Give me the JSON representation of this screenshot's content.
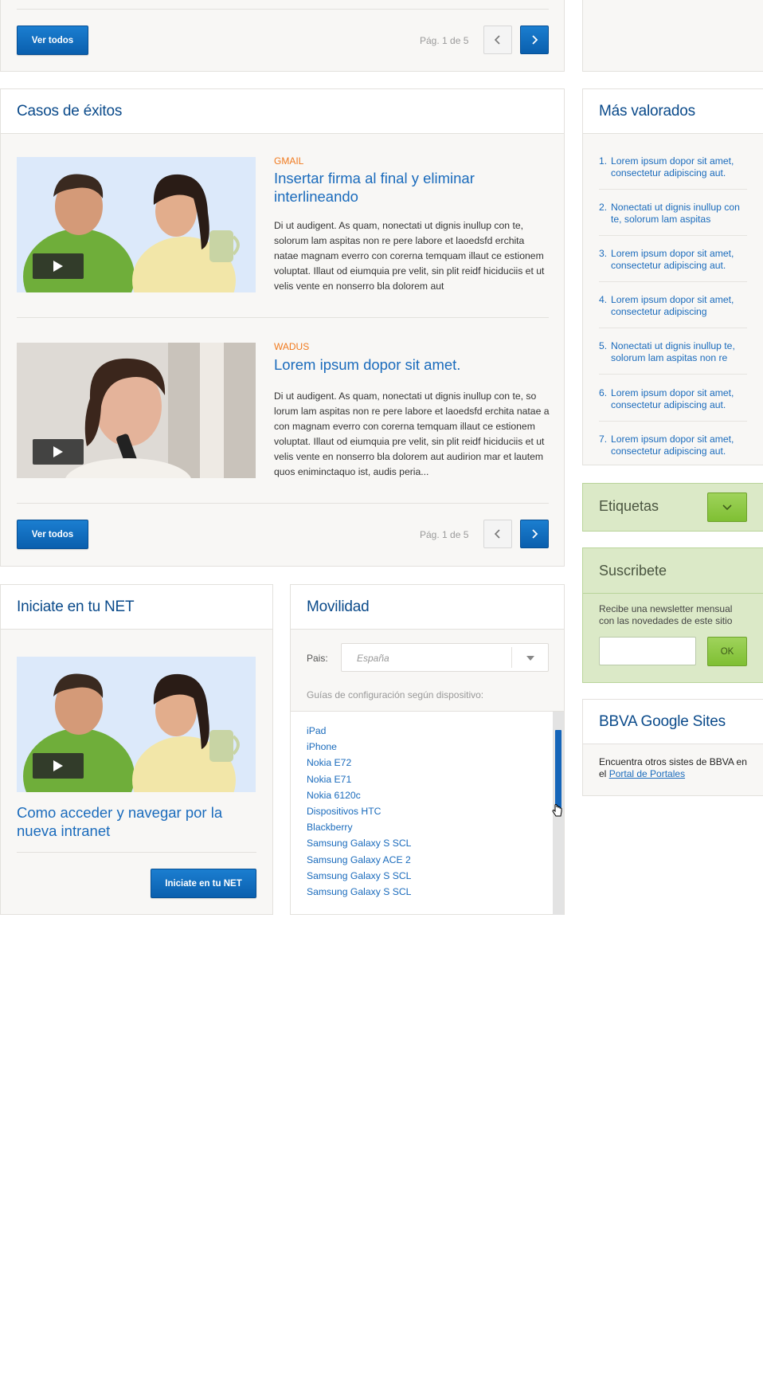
{
  "top_panel": {
    "button_label": "Ver todos",
    "pager_text": "Pág. 1 de 5"
  },
  "success_cases": {
    "title": "Casos de éxitos",
    "articles": [
      {
        "category": "GMAIL",
        "title": "Insertar firma al final y eliminar interlineando",
        "body": "Di ut audigent. As quam, nonectati ut dignis inullup con te, solorum lam aspitas non re pere labore et laoedsfd erchita natae magnam everro con corerna temquam illaut ce estionem voluptat. Illaut od eiumquia pre velit, sin plit reidf hiciduciis et ut velis vente en nonserro bla dolorem aut"
      },
      {
        "category": "WADUS",
        "title": "Lorem ipsum dopor sit amet.",
        "body": "Di ut audigent. As quam, nonectati ut dignis inullup con te, so lorum lam aspitas non re pere labore et laoedsfd erchita natae a con magnam everro con corerna temquam illaut ce estionem voluptat. Illaut od eiumquia pre velit, sin plit reidf hiciduciis et ut velis vente en nonserro bla dolorem aut audirion mar et lautem quos eniminctaquo ist, audis peria..."
      }
    ],
    "button_label": "Ver todos",
    "pager_text": "Pág. 1 de 5"
  },
  "start_net": {
    "title": "Iniciate en tu NET",
    "video_title": "Como acceder y navegar por la nueva intranet",
    "button_label": "Iniciate en tu NET"
  },
  "mobility": {
    "title": "Movilidad",
    "country_label": "Pais:",
    "country_placeholder": "España",
    "guides_label": "Guías de configuración según dispositivo:",
    "devices": [
      "iPad",
      "iPhone",
      "Nokia E72",
      "Nokia E71",
      "Nokia 6120c",
      "Dispositivos HTC",
      "Blackberry",
      "Samsung Galaxy S SCL",
      "Samsung Galaxy ACE 2",
      "Samsung Galaxy S SCL",
      "Samsung Galaxy S SCL"
    ]
  },
  "most_valued": {
    "title": "Más valorados",
    "items": [
      {
        "num": "1.",
        "text": "Lorem ipsum dopor sit amet, consectetur adipiscing aut."
      },
      {
        "num": "2.",
        "text": "Nonectati ut dignis inullup con te, solorum lam aspitas"
      },
      {
        "num": "3.",
        "text": "Lorem ipsum dopor sit amet, consectetur adipiscing aut."
      },
      {
        "num": "4.",
        "text": "Lorem ipsum dopor sit amet, consectetur adipiscing"
      },
      {
        "num": "5.",
        "text": "Nonectati ut dignis inullup te, solorum lam aspitas non re"
      },
      {
        "num": "6.",
        "text": "Lorem ipsum dopor sit amet, consectetur adipiscing aut."
      },
      {
        "num": "7.",
        "text": "Lorem ipsum dopor sit amet, consectetur adipiscing aut."
      }
    ]
  },
  "tags": {
    "title": "Etiquetas"
  },
  "subscribe": {
    "title": "Suscribete",
    "description": "Recibe una newsletter mensual con las novedades de este sitio",
    "button_label": "OK"
  },
  "google_sites": {
    "title": "BBVA Google Sites",
    "text_before": "Encuentra otros sistes de BBVA en el ",
    "link_label": "Portal de Portales"
  },
  "colors": {
    "brand_blue": "#0a4a8a",
    "link_blue": "#1a6bbc",
    "accent_orange": "#f07a1e",
    "green_panel": "#dbe9c7"
  }
}
